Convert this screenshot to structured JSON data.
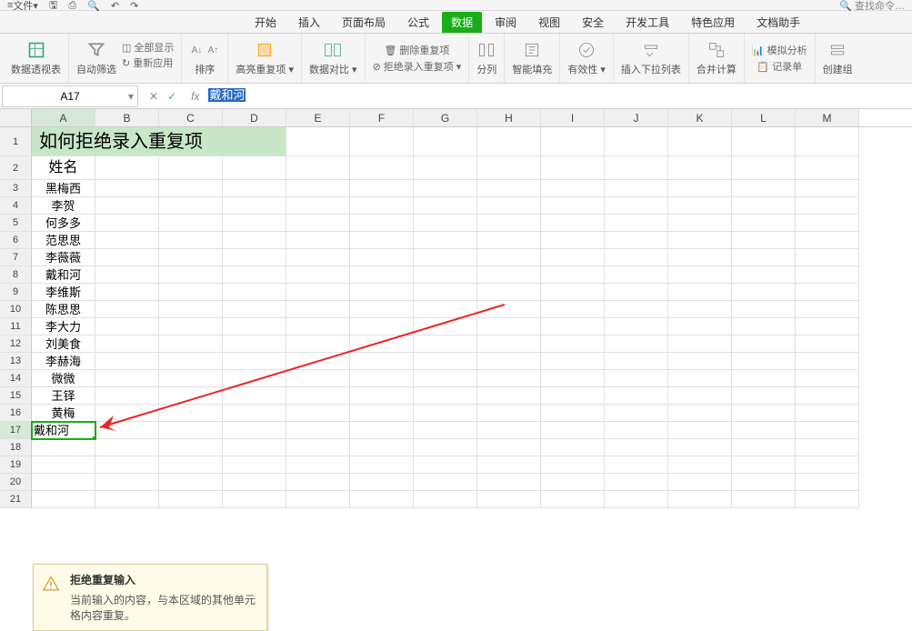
{
  "qat": {
    "file": "文件",
    "save": "",
    "undo": "",
    "redo": "",
    "print": ""
  },
  "search_cmd": "查找命令…",
  "tabs": [
    {
      "label": "开始"
    },
    {
      "label": "插入"
    },
    {
      "label": "页面布局"
    },
    {
      "label": "公式"
    },
    {
      "label": "数据",
      "active": true
    },
    {
      "label": "审阅"
    },
    {
      "label": "视图"
    },
    {
      "label": "安全"
    },
    {
      "label": "开发工具"
    },
    {
      "label": "特色应用"
    },
    {
      "label": "文档助手"
    }
  ],
  "ribbon": {
    "pivot": "数据透视表",
    "filter": "自动筛选",
    "show_all": "全部显示",
    "reapply": "重新应用",
    "sort": "排序",
    "hl_dup": "高亮重复项",
    "data_cmp": "数据对比",
    "del_dup": "删除重复项",
    "reject_dup": "拒绝录入重复项",
    "split": "分列",
    "smart_fill": "智能填充",
    "validity": "有效性",
    "dropdown": "插入下拉列表",
    "consolidate": "合并计算",
    "whatif": "模拟分析",
    "record": "记录单",
    "group": "创建组"
  },
  "name_box": "A17",
  "formula": "戴和河",
  "columns": [
    "A",
    "B",
    "C",
    "D",
    "E",
    "F",
    "G",
    "H",
    "I",
    "J",
    "K",
    "L",
    "M"
  ],
  "rows": [
    {
      "n": 1,
      "a": "如何拒绝录入重复项"
    },
    {
      "n": 2,
      "a": "姓名"
    },
    {
      "n": 3,
      "a": "黑梅西"
    },
    {
      "n": 4,
      "a": "李贺"
    },
    {
      "n": 5,
      "a": "何多多"
    },
    {
      "n": 6,
      "a": "范思思"
    },
    {
      "n": 7,
      "a": "李薇薇"
    },
    {
      "n": 8,
      "a": "戴和河"
    },
    {
      "n": 9,
      "a": "李维斯"
    },
    {
      "n": 10,
      "a": "陈思思"
    },
    {
      "n": 11,
      "a": "李大力"
    },
    {
      "n": 12,
      "a": "刘美食"
    },
    {
      "n": 13,
      "a": "李赫海"
    },
    {
      "n": 14,
      "a": "微微"
    },
    {
      "n": 15,
      "a": "王铎"
    },
    {
      "n": 16,
      "a": "黄梅"
    },
    {
      "n": 17,
      "a": "戴和河"
    },
    {
      "n": 18,
      "a": ""
    },
    {
      "n": 19,
      "a": ""
    },
    {
      "n": 20,
      "a": ""
    },
    {
      "n": 21,
      "a": ""
    }
  ],
  "tooltip": {
    "title": "拒绝重复输入",
    "body": "当前输入的内容，与本区域的其他单元格内容重复。"
  }
}
